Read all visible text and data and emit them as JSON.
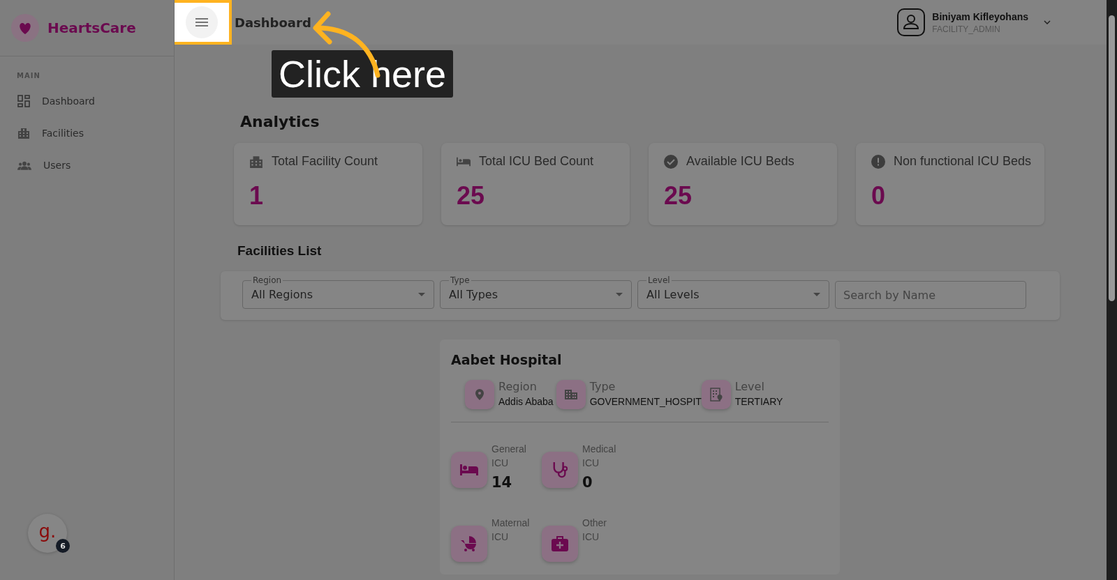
{
  "guide": {
    "tooltip": "Click here"
  },
  "sidebar": {
    "brand": "HeartsCare",
    "section": "MAIN",
    "items": [
      {
        "label": "Dashboard"
      },
      {
        "label": "Facilities"
      },
      {
        "label": "Users"
      }
    ]
  },
  "header": {
    "title": "Dashboard",
    "user": {
      "name": "Biniyam Kifleyohans",
      "role": "FACILITY_ADMIN"
    }
  },
  "analytics": {
    "title": "Analytics",
    "cards": [
      {
        "label": "Total Facility Count",
        "value": "1"
      },
      {
        "label": "Total ICU Bed Count",
        "value": "25"
      },
      {
        "label": "Available ICU Beds",
        "value": "25"
      },
      {
        "label": "Non functional ICU Beds",
        "value": "0"
      }
    ]
  },
  "facilities": {
    "title": "Facilities List",
    "filters": [
      {
        "label": "Region",
        "value": "All Regions"
      },
      {
        "label": "Type",
        "value": "All Types"
      },
      {
        "label": "Level",
        "value": "All Levels"
      }
    ],
    "search": {
      "placeholder": "Search by Name"
    },
    "hospitals": [
      {
        "name": "Aabet Hospital",
        "details": [
          {
            "label": "Region",
            "value": "Addis Ababa"
          },
          {
            "label": "Type",
            "value": "GOVERNMENT_HOSPIT"
          },
          {
            "label": "Level",
            "value": "TERTIARY"
          }
        ],
        "icu": [
          {
            "label": "General ICU",
            "value": "14"
          },
          {
            "label": "Medical ICU",
            "value": "0"
          },
          {
            "label": "Maternal ICU"
          },
          {
            "label": "Other ICU"
          }
        ]
      }
    ]
  },
  "widget": {
    "logo": "g.",
    "badge": "6"
  }
}
